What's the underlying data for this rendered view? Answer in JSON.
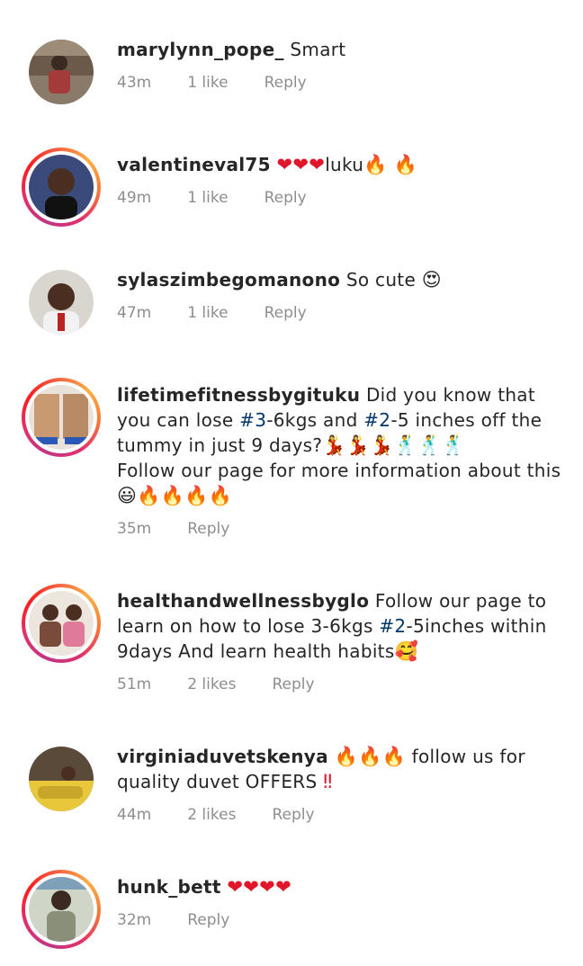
{
  "colors": {
    "hashtag": "#00376b",
    "meta": "#8e8e8e",
    "heart": "#e0162b",
    "fire": "#f77f00"
  },
  "comments": [
    {
      "username": "marylynn_pope_",
      "text": "Smart",
      "time": "43m",
      "likes": "1 like",
      "reply": "Reply"
    },
    {
      "username": "valentineval75",
      "text": "luku",
      "time": "49m",
      "likes": "1 like",
      "reply": "Reply"
    },
    {
      "username": "sylaszimbegomanono",
      "text": "So cute",
      "time": "47m",
      "likes": "1 like",
      "reply": "Reply"
    },
    {
      "username": "lifetimefitnessbygituku",
      "text_a": "Did you know that you  can lose ",
      "tag1": "#3",
      "text_b": "-6kgs and ",
      "tag2": "#2",
      "text_c": "-5 inches off the tummy in just 9 days?",
      "text_d": "Follow our page for more information about this",
      "time": "35m",
      "reply": "Reply"
    },
    {
      "username": "healthandwellnessbyglo",
      "text_a": "Follow our page to learn on how to lose 3-6kgs ",
      "tag1": "#2",
      "text_b": "-5inches within 9days And learn health habits",
      "time": "51m",
      "likes": "2 likes",
      "reply": "Reply"
    },
    {
      "username": "virginiaduvetskenya",
      "text": "follow us for quality duvet OFFERS",
      "time": "44m",
      "likes": "2 likes",
      "reply": "Reply"
    },
    {
      "username": "hunk_bett",
      "time": "32m",
      "reply": "Reply"
    }
  ]
}
